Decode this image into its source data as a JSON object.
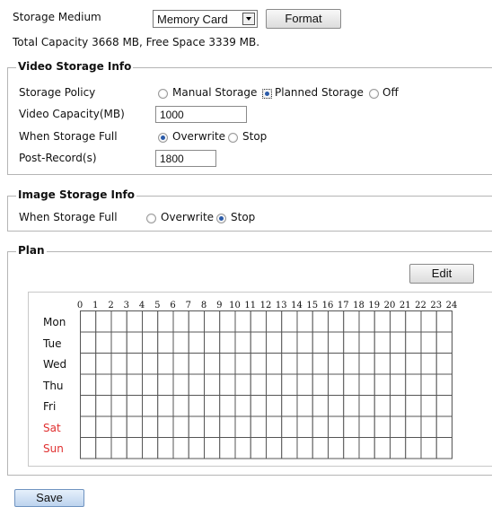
{
  "storage": {
    "medium_label": "Storage Medium",
    "medium_value": "Memory Card",
    "format_label": "Format",
    "capacity_text": "Total Capacity 3668 MB, Free Space 3339 MB."
  },
  "video": {
    "legend": "Video Storage Info",
    "policy_label": "Storage Policy",
    "policy_options": [
      "Manual Storage",
      "Planned Storage",
      "Off"
    ],
    "policy_selected": "Planned Storage",
    "capacity_label": "Video Capacity(MB)",
    "capacity_value": "1000",
    "full_label": "When Storage Full",
    "full_options": [
      "Overwrite",
      "Stop"
    ],
    "full_selected": "Overwrite",
    "postrecord_label": "Post-Record(s)",
    "postrecord_value": "1800"
  },
  "image": {
    "legend": "Image Storage Info",
    "full_label": "When Storage Full",
    "full_options": [
      "Overwrite",
      "Stop"
    ],
    "full_selected": "Stop"
  },
  "plan": {
    "legend": "Plan",
    "edit_label": "Edit",
    "hours": [
      "0",
      "1",
      "2",
      "3",
      "4",
      "5",
      "6",
      "7",
      "8",
      "9",
      "10",
      "11",
      "12",
      "13",
      "14",
      "15",
      "16",
      "17",
      "18",
      "19",
      "20",
      "21",
      "22",
      "23",
      "24"
    ],
    "days": [
      "Mon",
      "Tue",
      "Wed",
      "Thu",
      "Fri",
      "Sat",
      "Sun"
    ],
    "weekend_color": "#e03030"
  },
  "save_label": "Save"
}
